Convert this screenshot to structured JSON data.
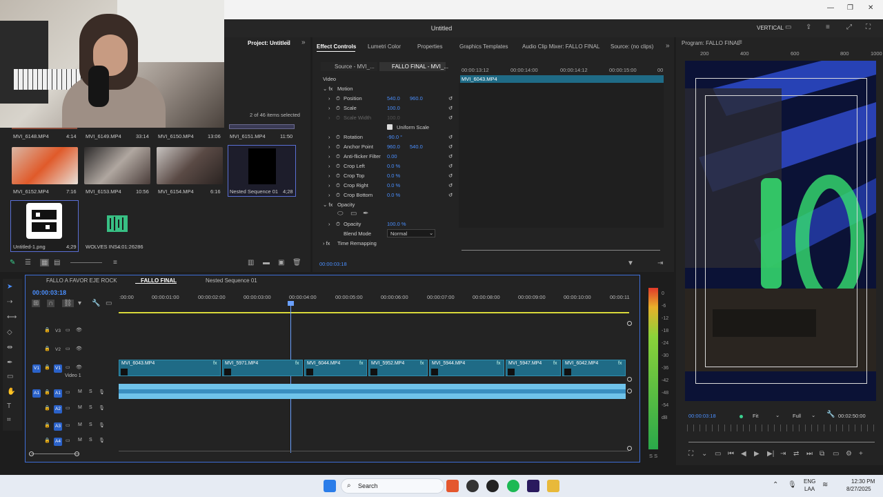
{
  "window": {
    "title": "Untitled",
    "mode_label": "VERTICAL"
  },
  "project_panel": {
    "tab_label": "Project: Untitled",
    "items_selected": "2 of 46 items selected",
    "items": [
      {
        "name": "MVI_6148.MP4",
        "duration": "4:14"
      },
      {
        "name": "MVI_6149.MP4",
        "duration": "33:14"
      },
      {
        "name": "MVI_6150.MP4",
        "duration": "13:06"
      },
      {
        "name": "MVI_6151.MP4",
        "duration": "11:50"
      },
      {
        "name": "MVI_6152.MP4",
        "duration": "7:16"
      },
      {
        "name": "MVI_6153.MP4",
        "duration": "10:56"
      },
      {
        "name": "MVI_6154.MP4",
        "duration": "6:16"
      },
      {
        "name": "Nested Sequence 01",
        "duration": "4;28"
      },
      {
        "name": "Untitled-1.png",
        "duration": "4;29"
      },
      {
        "name": "WOLVES INS...",
        "duration": "4:01:26286"
      }
    ]
  },
  "effect_tabs": [
    "Effect Controls",
    "Lumetri Color",
    "Properties",
    "Graphics Templates",
    "Audio Clip Mixer: FALLO FINAL",
    "Source: (no clips)"
  ],
  "effect_controls": {
    "source_tab": "Source - MVI_...",
    "seq_tab": "FALLO FINAL - MVI_...",
    "section_video": "Video",
    "clip_label": "MVI_6043.MP4",
    "ruler": [
      "00:00:13:12",
      "00:00:14:00",
      "00:00:14:12",
      "00:00:15:00",
      "00"
    ],
    "motion": "Motion",
    "rows": [
      {
        "name": "Position",
        "v1": "540.0",
        "v2": "960.0"
      },
      {
        "name": "Scale",
        "v1": "100.0",
        "v2": ""
      },
      {
        "name": "Scale Width",
        "v1": "100.0",
        "v2": ""
      },
      {
        "name": "Rotation",
        "v1": "-90.0 °",
        "v2": ""
      },
      {
        "name": "Anchor Point",
        "v1": "960.0",
        "v2": "540.0"
      },
      {
        "name": "Anti-flicker Filter",
        "v1": "0.00",
        "v2": ""
      },
      {
        "name": "Crop Left",
        "v1": "0.0 %",
        "v2": ""
      },
      {
        "name": "Crop Top",
        "v1": "0.0 %",
        "v2": ""
      },
      {
        "name": "Crop Right",
        "v1": "0.0 %",
        "v2": ""
      },
      {
        "name": "Crop Bottom",
        "v1": "0.0 %",
        "v2": ""
      }
    ],
    "uniform_scale": "Uniform Scale",
    "opacity_section": "Opacity",
    "opacity_name": "Opacity",
    "opacity_value": "100.0 %",
    "blend_mode_label": "Blend Mode",
    "blend_mode_value": "Normal",
    "time_remap": "Time Remapping",
    "timecode": "00:00:03:18"
  },
  "program_monitor": {
    "title": "Program: FALLO FINAL",
    "ruler": [
      "200",
      "400",
      "600",
      "800",
      "1000"
    ],
    "timecode": "00:00:03:18",
    "fit": "Fit",
    "quality": "Full",
    "duration": "00:02:50:00"
  },
  "timeline": {
    "tabs": [
      "FALLO A FAVOR EJE ROCK",
      "FALLO FINAL",
      "Nested Sequence 01"
    ],
    "timecode": "00:00:03:18",
    "ruler": [
      ":00:00",
      "00:00:01:00",
      "00:00:02:00",
      "00:00:03:00",
      "00:00:04:00",
      "00:00:05:00",
      "00:00:06:00",
      "00:00:07:00",
      "00:00:08:00",
      "00:00:09:00",
      "00:00:10:00",
      "00:00:11"
    ],
    "video_tracks": [
      {
        "id": "V3"
      },
      {
        "id": "V2"
      },
      {
        "id": "V1",
        "label": "Video 1"
      }
    ],
    "audio_tracks": [
      "A1",
      "A2",
      "A3",
      "A4"
    ],
    "track_flags": {
      "mute": "M",
      "solo": "S"
    },
    "clips": [
      "MVI_6043.MP4",
      "MVI_5971.MP4",
      "MVI_6044.MP4",
      "MVI_5952.MP4",
      "MVI_5944.MP4",
      "MVI_5947.MP4",
      "MVI_6042.MP4"
    ],
    "fx_badge": "fx"
  },
  "meter_scale": [
    "0",
    "-6",
    "-12",
    "-18",
    "-24",
    "-30",
    "-36",
    "-42",
    "-48",
    "-54",
    "dB"
  ],
  "meter_footer": "S S",
  "taskbar": {
    "search": "Search",
    "lang": "ENG",
    "lang2": "LAA",
    "time": "12:30 PM",
    "date": "8/27/2025"
  }
}
